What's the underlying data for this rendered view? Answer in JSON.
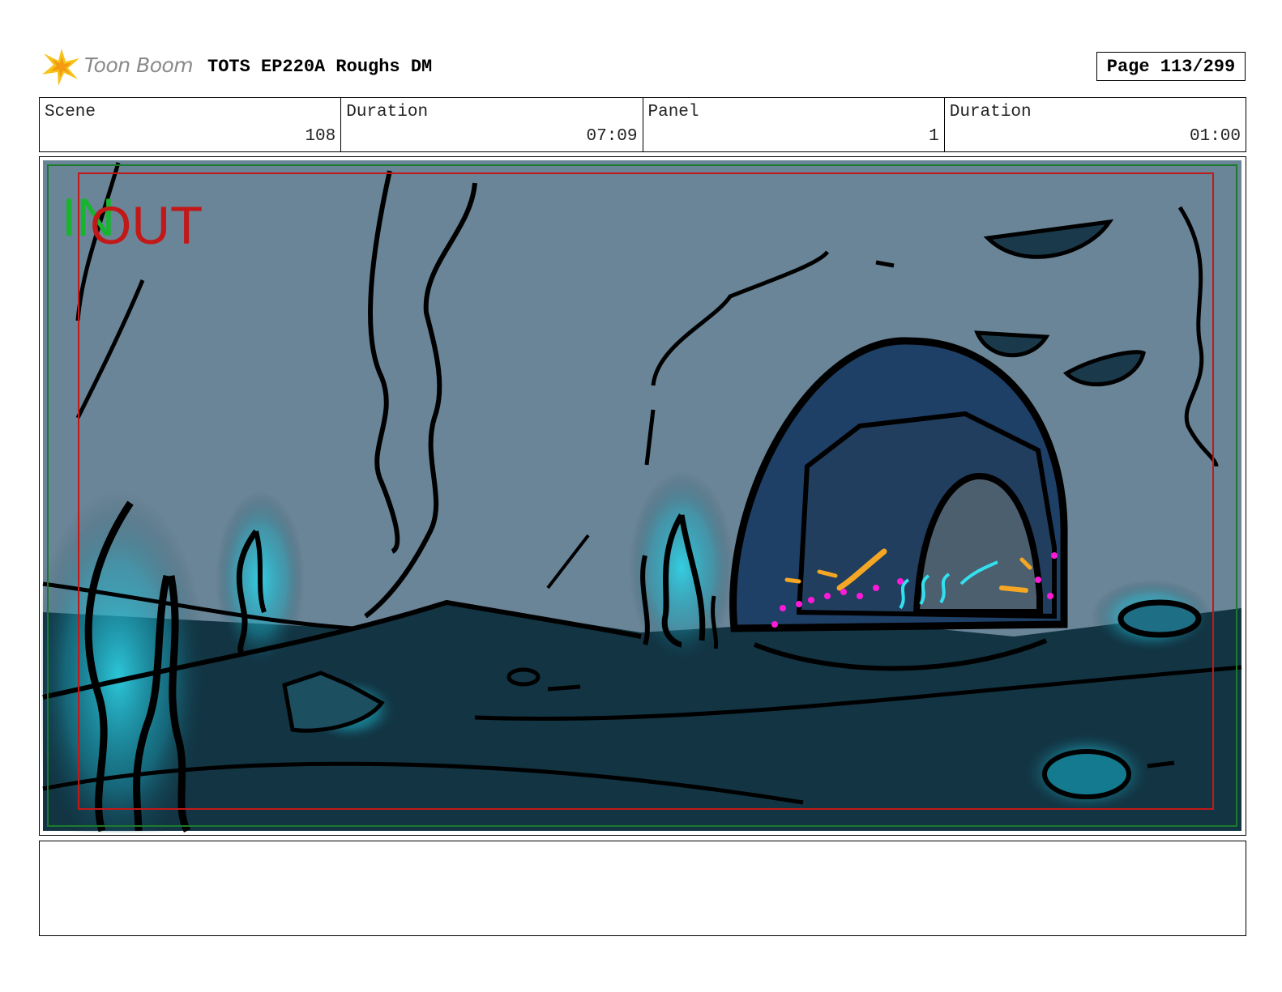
{
  "header": {
    "logo_text": "Toon Boom",
    "title": "TOTS EP220A Roughs DM",
    "page": "Page 113/299"
  },
  "info": {
    "scene_label": "Scene",
    "scene_value": "108",
    "scene_duration_label": "Duration",
    "scene_duration_value": "07:09",
    "panel_label": "Panel",
    "panel_value": "1",
    "panel_duration_label": "Duration",
    "panel_duration_value": "01:00"
  },
  "frame_marks": {
    "in_label": "IN",
    "out_label": "OUT"
  },
  "notes": {
    "text": ""
  }
}
